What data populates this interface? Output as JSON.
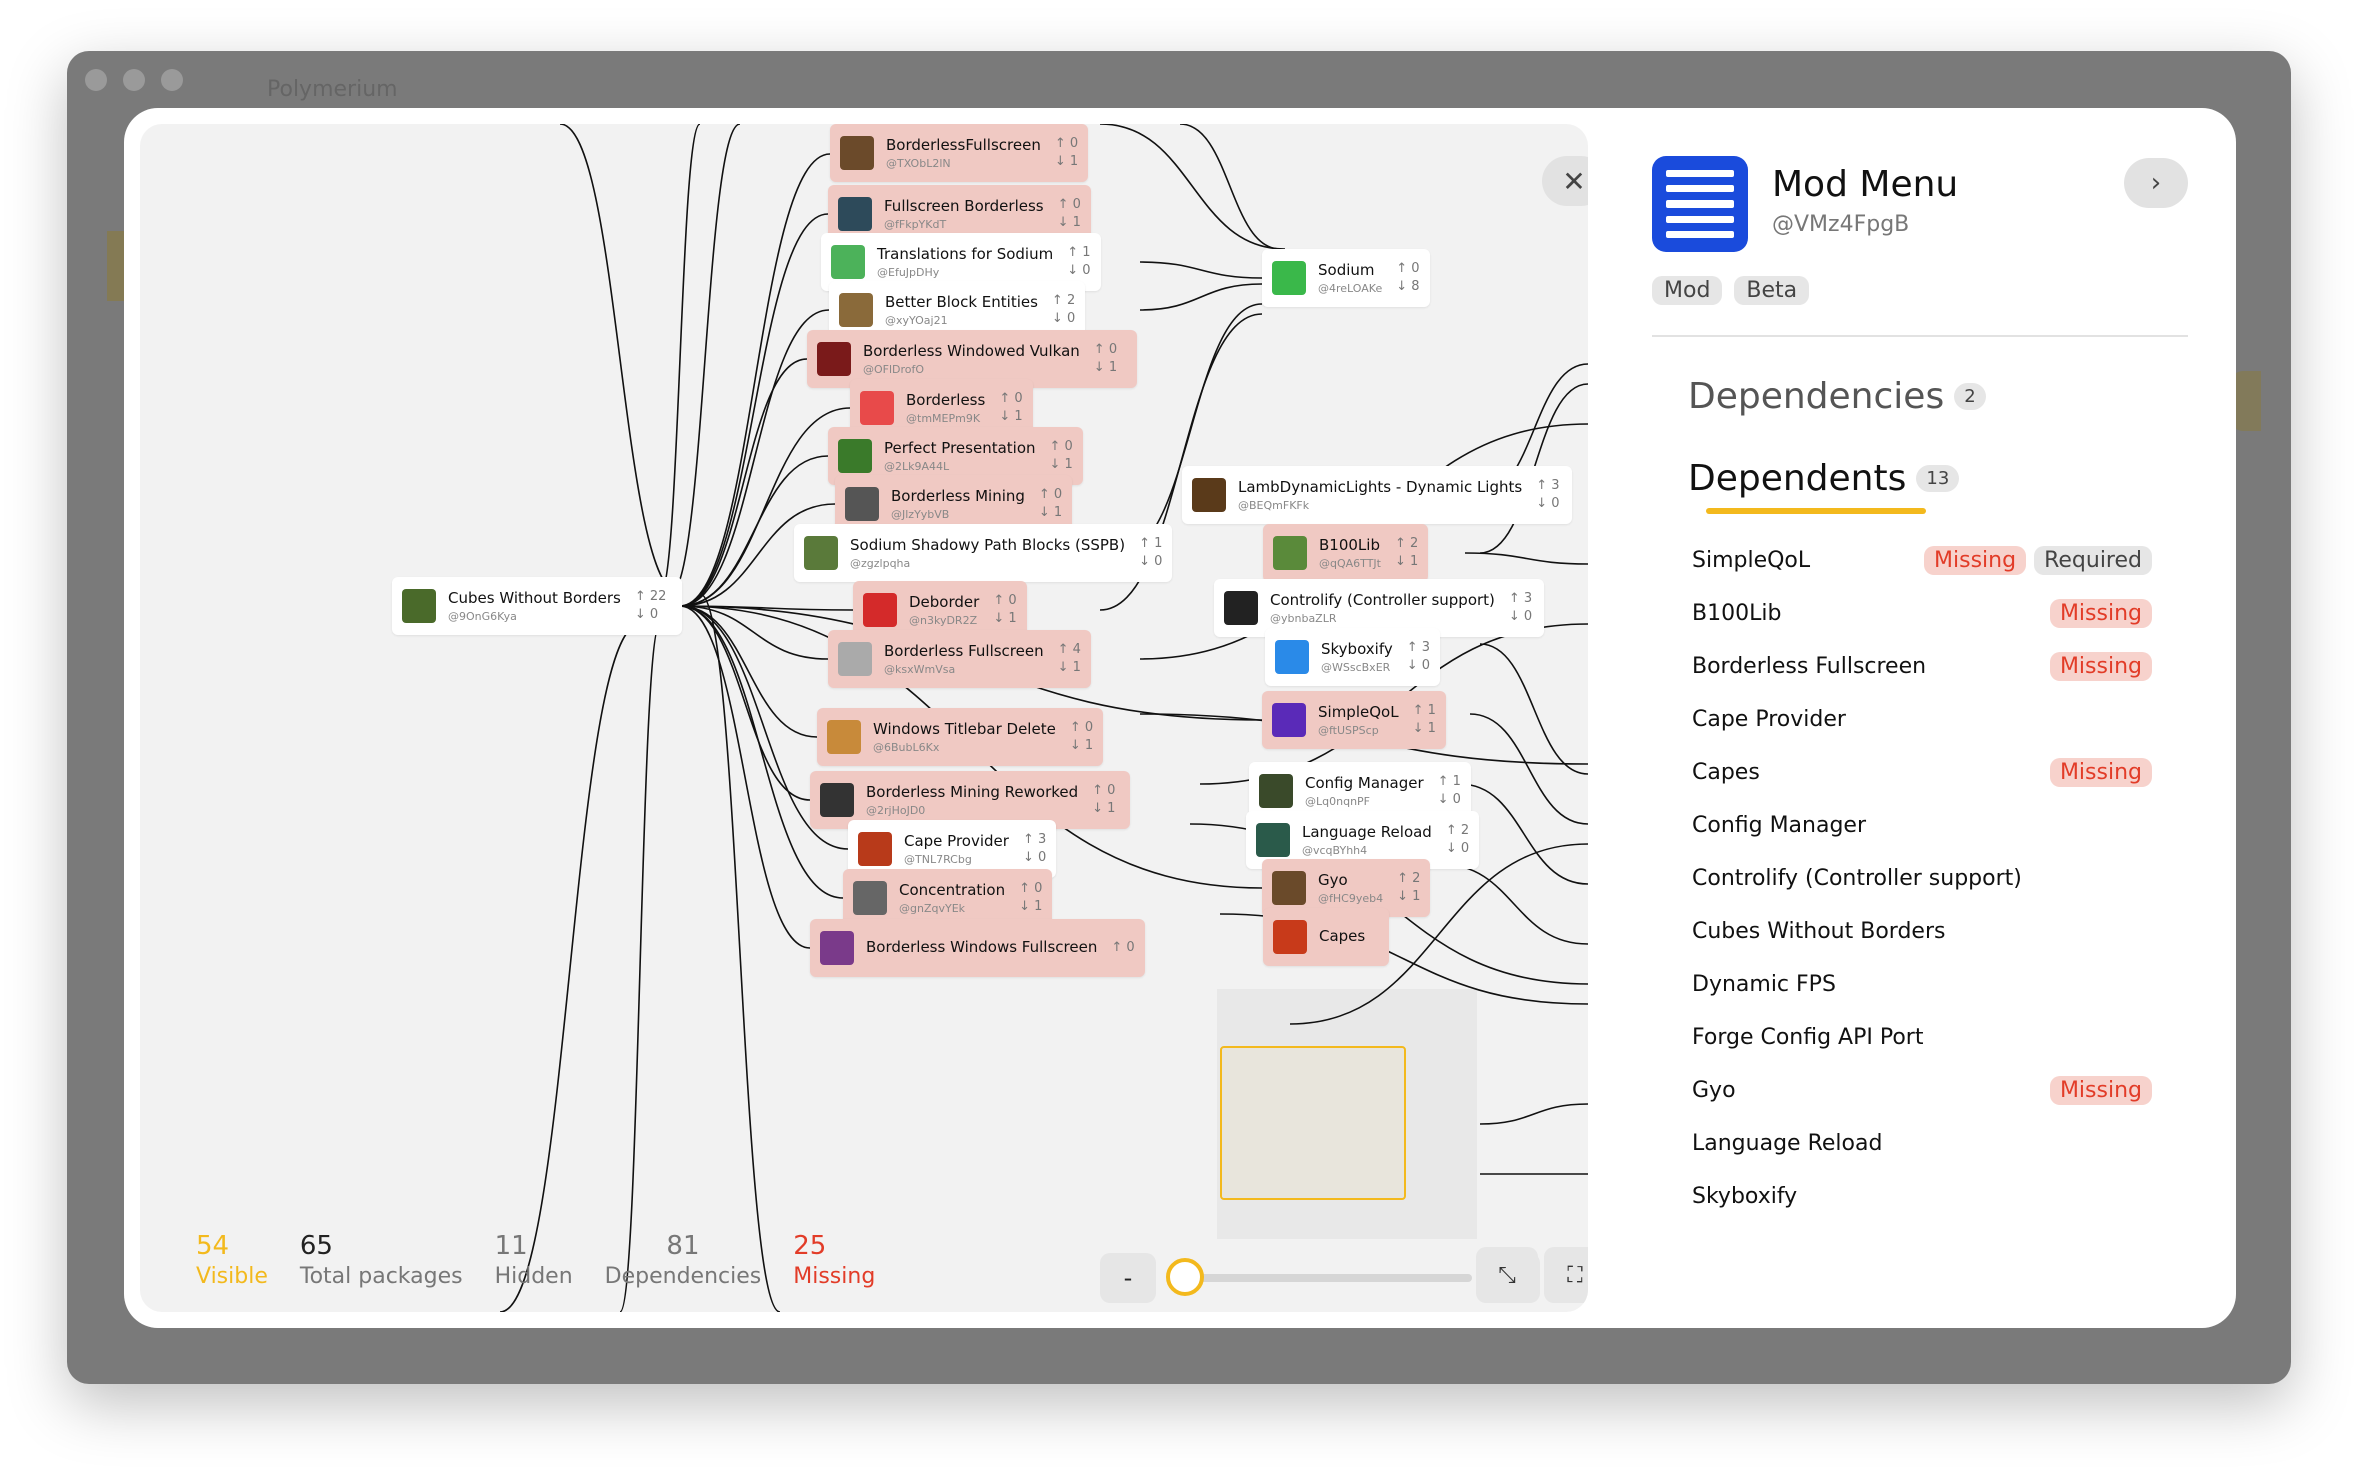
{
  "window": {
    "app_title": "Polymerium"
  },
  "colors": {
    "accent": "#f3b91d",
    "missing": "#e23c28",
    "missing_bg": "#f0c9c3",
    "mod_icon": "#1a4bdc"
  },
  "graph": {
    "nodes": [
      {
        "id": "n1",
        "name": "BorderlessFullscreen",
        "handle": "@TXObL2lN",
        "up": "0",
        "down": "1",
        "missing": true,
        "icon": "#6b4a2a"
      },
      {
        "id": "n2",
        "name": "Fullscreen Borderless",
        "handle": "@fFkpYKdT",
        "up": "0",
        "down": "1",
        "missing": true,
        "icon": "#2d4a5a"
      },
      {
        "id": "n3",
        "name": "Translations for Sodium",
        "handle": "@EfuJpDHy",
        "up": "1",
        "down": "0",
        "missing": false,
        "icon": "#4cb25a"
      },
      {
        "id": "n4",
        "name": "Better Block Entities",
        "handle": "@xyYOaj21",
        "up": "2",
        "down": "0",
        "missing": false,
        "icon": "#8a6a3a"
      },
      {
        "id": "n5",
        "name": "Borderless Windowed Vulkan",
        "handle": "@OFlDrofO",
        "up": "0",
        "down": "1",
        "missing": true,
        "icon": "#7a1a1a"
      },
      {
        "id": "n6",
        "name": "Borderless",
        "handle": "@tmMEPm9K",
        "up": "0",
        "down": "1",
        "missing": true,
        "icon": "#e84a4a"
      },
      {
        "id": "n7",
        "name": "Perfect Presentation",
        "handle": "@2Lk9A44L",
        "up": "0",
        "down": "1",
        "missing": true,
        "icon": "#3a7a2a"
      },
      {
        "id": "n8",
        "name": "Borderless Mining",
        "handle": "@JlzYybVB",
        "up": "0",
        "down": "1",
        "missing": true,
        "icon": "#555555"
      },
      {
        "id": "n9",
        "name": "Sodium Shadowy Path Blocks (SSPB)",
        "handle": "@zgzlpqha",
        "up": "1",
        "down": "0",
        "missing": false,
        "icon": "#5a7a3a"
      },
      {
        "id": "n10",
        "name": "Cubes Without Borders",
        "handle": "@9OnG6Kya",
        "up": "22",
        "down": "0",
        "missing": false,
        "icon": "#4a6a2a"
      },
      {
        "id": "n11",
        "name": "Deborder",
        "handle": "@n3kyDR2Z",
        "up": "0",
        "down": "1",
        "missing": true,
        "icon": "#d42a2a"
      },
      {
        "id": "n12",
        "name": "Borderless Fullscreen",
        "handle": "@ksxWmVsa",
        "up": "4",
        "down": "1",
        "missing": true,
        "icon": "#aaaaaa"
      },
      {
        "id": "n13",
        "name": "Windows Titlebar Delete",
        "handle": "@6BubL6Kx",
        "up": "0",
        "down": "1",
        "missing": true,
        "icon": "#c88a3a"
      },
      {
        "id": "n14",
        "name": "Borderless Mining Reworked",
        "handle": "@2rjHoJD0",
        "up": "0",
        "down": "1",
        "missing": true,
        "icon": "#333333"
      },
      {
        "id": "n15",
        "name": "Cape Provider",
        "handle": "@TNL7RCbg",
        "up": "3",
        "down": "0",
        "missing": false,
        "icon": "#b83a1a"
      },
      {
        "id": "n16",
        "name": "Concentration",
        "handle": "@gnZqvYEk",
        "up": "0",
        "down": "1",
        "missing": true,
        "icon": "#666666"
      },
      {
        "id": "n17",
        "name": "Borderless Windows Fullscreen",
        "handle": "",
        "up": "0",
        "down": "",
        "missing": true,
        "icon": "#7a3a8a"
      },
      {
        "id": "n18",
        "name": "Sodium",
        "handle": "@4reLOAKe",
        "up": "0",
        "down": "8",
        "missing": false,
        "icon": "#3ab84a"
      },
      {
        "id": "n19",
        "name": "LambDynamicLights - Dynamic Lights",
        "handle": "@BEQmFKFk",
        "up": "3",
        "down": "0",
        "missing": false,
        "icon": "#5a3a1a"
      },
      {
        "id": "n20",
        "name": "B100Lib",
        "handle": "@qQA6TTJt",
        "up": "2",
        "down": "1",
        "missing": true,
        "icon": "#5a8a3a"
      },
      {
        "id": "n21",
        "name": "Controlify (Controller support)",
        "handle": "@ybnbaZLR",
        "up": "3",
        "down": "0",
        "missing": false,
        "icon": "#222222"
      },
      {
        "id": "n22",
        "name": "Skyboxify",
        "handle": "@WSscBxER",
        "up": "3",
        "down": "0",
        "missing": false,
        "icon": "#2a8ae8"
      },
      {
        "id": "n23",
        "name": "SimpleQoL",
        "handle": "@ftUSPScp",
        "up": "1",
        "down": "1",
        "missing": true,
        "icon": "#5a2ab8"
      },
      {
        "id": "n24",
        "name": "Config Manager",
        "handle": "@Lq0nqnPF",
        "up": "1",
        "down": "0",
        "missing": false,
        "icon": "#3a4a2a"
      },
      {
        "id": "n25",
        "name": "Language Reload",
        "handle": "@vcqBYhh4",
        "up": "2",
        "down": "0",
        "missing": false,
        "icon": "#2a5a4a"
      },
      {
        "id": "n26",
        "name": "Gyo",
        "handle": "@fHC9yeb4",
        "up": "2",
        "down": "1",
        "missing": true,
        "icon": "#6a4a2a"
      },
      {
        "id": "n27",
        "name": "Capes",
        "handle": "",
        "up": "",
        "down": "",
        "missing": true,
        "icon": "#c83a1a"
      }
    ]
  },
  "stats": [
    {
      "value": "54",
      "label": "Visible",
      "kind": "vis"
    },
    {
      "value": "65",
      "label": "Total packages",
      "kind": "tot"
    },
    {
      "value": "11",
      "label": "Hidden",
      "kind": "hid"
    },
    {
      "value": "81",
      "label": "Dependencies",
      "kind": "dep"
    },
    {
      "value": "25",
      "label": "Missing",
      "kind": "mis"
    }
  ],
  "zoom": {
    "minus": "-",
    "plus": "+",
    "level": 0.02
  },
  "panel": {
    "title": "Mod Menu",
    "handle": "@VMz4FpgB",
    "tags": [
      "Mod",
      "Beta"
    ],
    "tabs": [
      {
        "label": "Dependencies",
        "count": "2"
      },
      {
        "label": "Dependents",
        "count": "13"
      }
    ],
    "badges": {
      "missing": "Missing",
      "required": "Required"
    },
    "dependents": [
      {
        "name": "SimpleQoL",
        "missing": true,
        "required": true
      },
      {
        "name": "B100Lib",
        "missing": true,
        "required": false
      },
      {
        "name": "Borderless Fullscreen",
        "missing": true,
        "required": false
      },
      {
        "name": "Cape Provider",
        "missing": false,
        "required": false
      },
      {
        "name": "Capes",
        "missing": true,
        "required": false
      },
      {
        "name": "Config Manager",
        "missing": false,
        "required": false
      },
      {
        "name": "Controlify (Controller support)",
        "missing": false,
        "required": false
      },
      {
        "name": "Cubes Without Borders",
        "missing": false,
        "required": false
      },
      {
        "name": "Dynamic FPS",
        "missing": false,
        "required": false
      },
      {
        "name": "Forge Config API Port",
        "missing": false,
        "required": false
      },
      {
        "name": "Gyo",
        "missing": true,
        "required": false
      },
      {
        "name": "Language Reload",
        "missing": false,
        "required": false
      },
      {
        "name": "Skyboxify",
        "missing": false,
        "required": false
      }
    ]
  }
}
